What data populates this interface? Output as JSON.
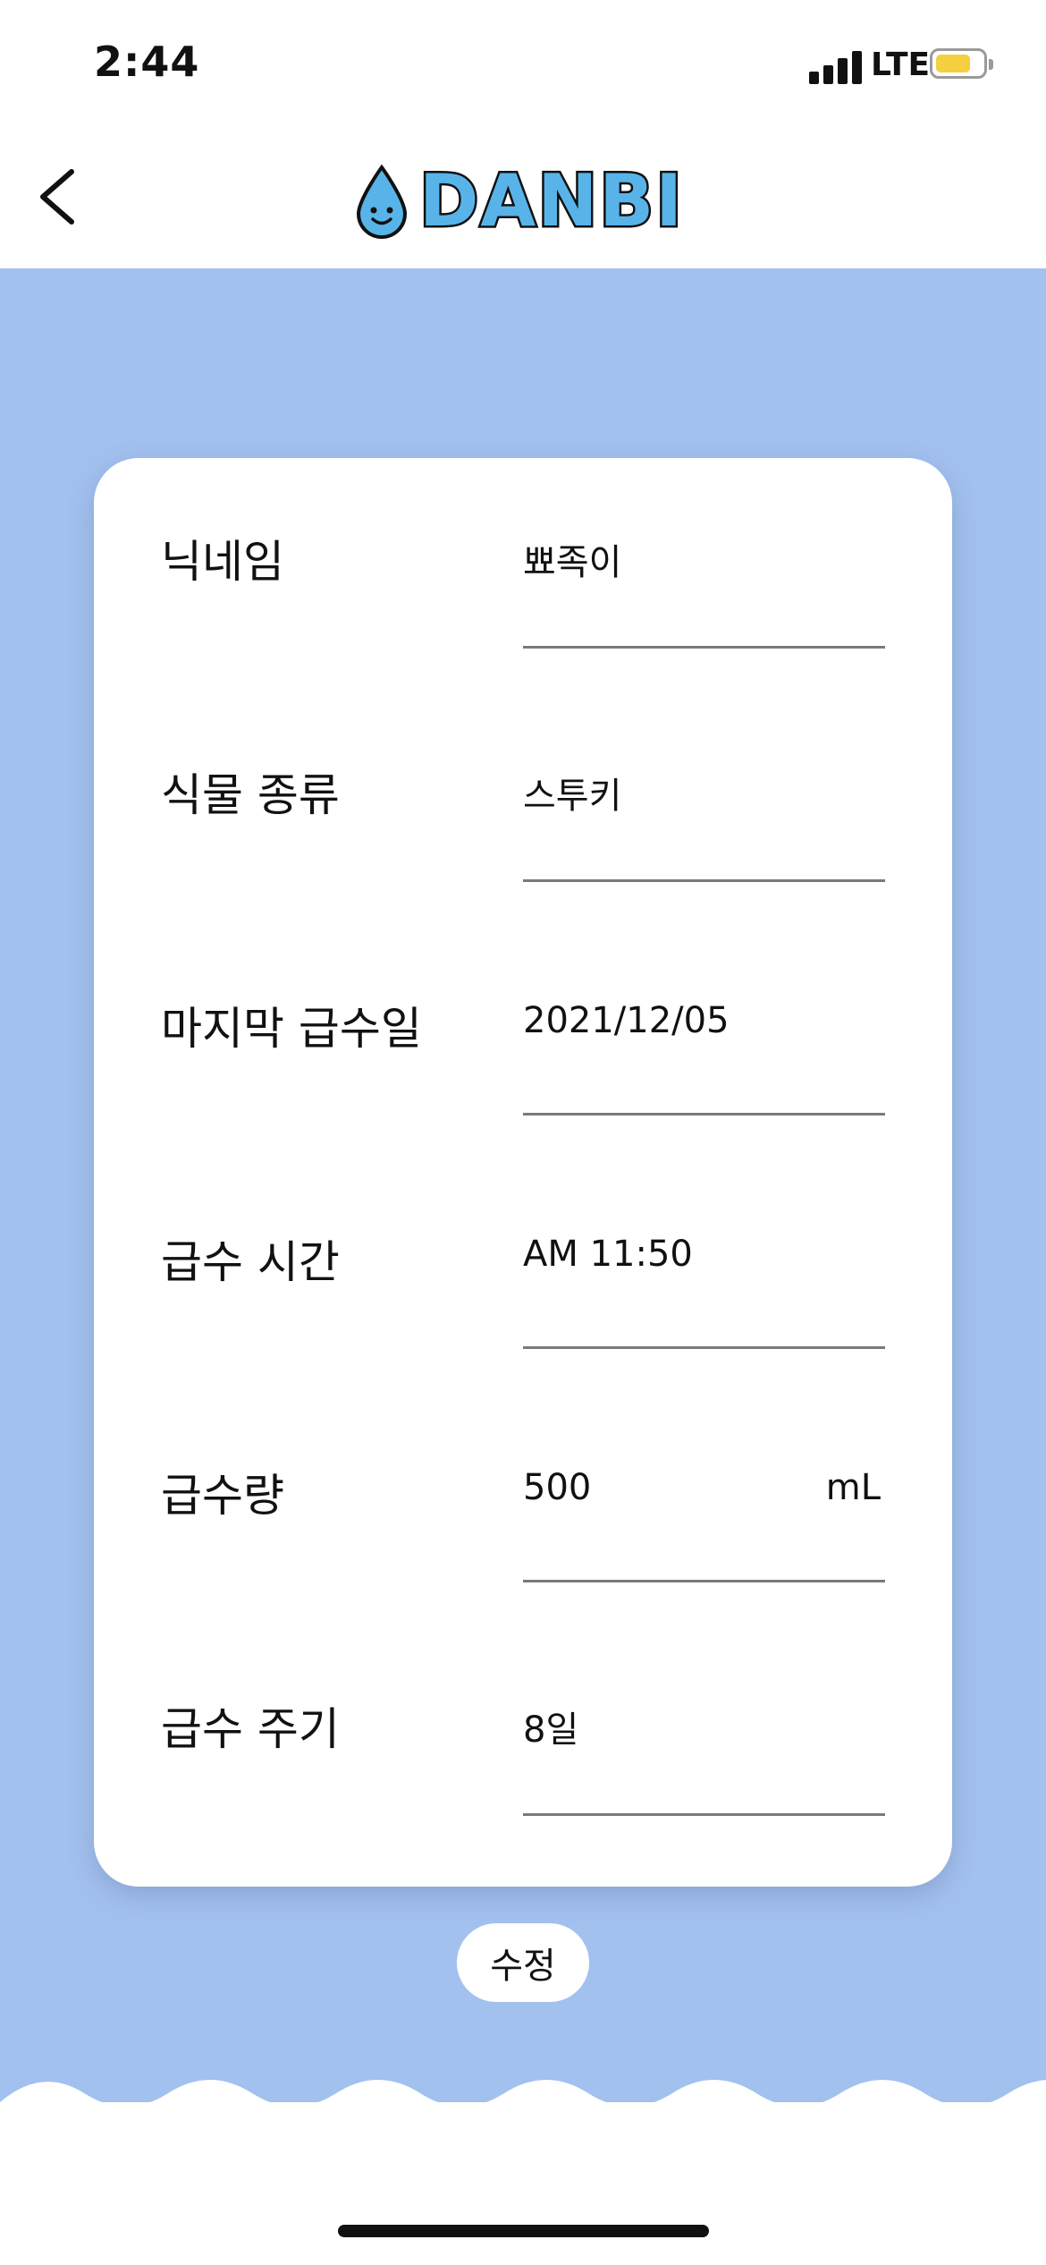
{
  "status_bar": {
    "time": "2:44",
    "network": "LTE",
    "battery_level": 0.6,
    "battery_color": "#f4cf3f"
  },
  "header": {
    "back_icon": "chevron-left-icon",
    "logo_text": "DANBI",
    "logo_icon": "water-drop-icon"
  },
  "colors": {
    "background": "#a3c1ef",
    "logo": "#58b4e8"
  },
  "form": {
    "fields": [
      {
        "label": "닉네임",
        "value": "뾰족이"
      },
      {
        "label": "식물 종류",
        "value": "스투키"
      },
      {
        "label": "마지막 급수일",
        "value": "2021/12/05"
      },
      {
        "label": "급수 시간",
        "value": "AM 11:50"
      },
      {
        "label": "급수량",
        "value": "500",
        "unit": "mL"
      },
      {
        "label": "급수 주기",
        "value": "8일"
      }
    ]
  },
  "edit_button": {
    "label": "수정"
  }
}
